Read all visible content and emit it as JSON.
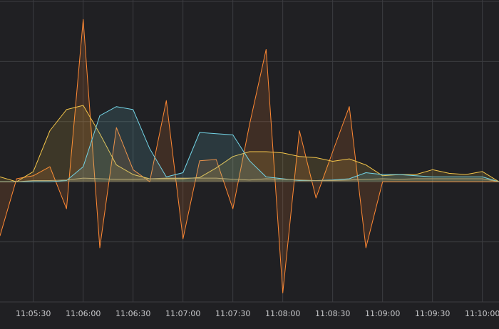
{
  "chart_data": {
    "type": "area",
    "title": "",
    "xlabel": "",
    "ylabel": "",
    "grid": true,
    "legend": "none",
    "xlim": [
      "11:05:10",
      "11:10:10"
    ],
    "ylim": [
      -2,
      3
    ],
    "x_ticks": [
      "11:05:30",
      "11:06:00",
      "11:06:30",
      "11:07:00",
      "11:07:30",
      "11:08:00",
      "11:08:30",
      "11:09:00",
      "11:09:30",
      "11:10:00"
    ],
    "y_grid": [
      -2,
      -1,
      0,
      1,
      2,
      3
    ],
    "x": [
      "11:05:10",
      "11:05:20",
      "11:05:30",
      "11:05:40",
      "11:05:50",
      "11:06:00",
      "11:06:10",
      "11:06:20",
      "11:06:30",
      "11:06:40",
      "11:06:50",
      "11:07:00",
      "11:07:10",
      "11:07:20",
      "11:07:30",
      "11:07:40",
      "11:07:50",
      "11:08:00",
      "11:08:10",
      "11:08:20",
      "11:08:30",
      "11:08:40",
      "11:08:50",
      "11:09:00",
      "11:09:10",
      "11:09:20",
      "11:09:30",
      "11:09:40",
      "11:09:50",
      "11:10:00",
      "11:10:10"
    ],
    "series": [
      {
        "color": "#ff8833",
        "values": [
          -0.9,
          0.05,
          0.1,
          0.25,
          -0.45,
          2.7,
          -1.1,
          0.9,
          0.2,
          0.0,
          1.35,
          -0.95,
          0.35,
          0.37,
          -0.45,
          0.95,
          2.2,
          -1.85,
          0.85,
          -0.27,
          0.5,
          1.25,
          -1.1,
          0.0,
          0.0,
          0.0,
          0.0,
          0.0,
          0.0,
          0.0,
          0.0
        ]
      },
      {
        "color": "#f2c44a",
        "values": [
          0.08,
          0.0,
          0.17,
          0.85,
          1.2,
          1.27,
          0.8,
          0.28,
          0.12,
          0.05,
          0.05,
          0.05,
          0.07,
          0.23,
          0.42,
          0.5,
          0.5,
          0.48,
          0.42,
          0.4,
          0.34,
          0.38,
          0.28,
          0.1,
          0.12,
          0.12,
          0.2,
          0.14,
          0.12,
          0.17,
          0.0
        ]
      },
      {
        "color": "#73d4e6",
        "values": [
          0.0,
          0.0,
          0.0,
          0.0,
          0.02,
          0.25,
          1.1,
          1.25,
          1.2,
          0.55,
          0.08,
          0.15,
          0.82,
          0.8,
          0.78,
          0.35,
          0.08,
          0.05,
          0.02,
          0.02,
          0.03,
          0.05,
          0.15,
          0.12,
          0.12,
          0.1,
          0.08,
          0.08,
          0.08,
          0.08,
          0.0
        ]
      },
      {
        "color": "#b6a873",
        "values": [
          0.0,
          0.0,
          0.02,
          0.02,
          0.03,
          0.06,
          0.05,
          0.04,
          0.04,
          0.05,
          0.06,
          0.06,
          0.06,
          0.06,
          0.04,
          0.03,
          0.05,
          0.04,
          0.03,
          0.02,
          0.02,
          0.03,
          0.04,
          0.05,
          0.04,
          0.05,
          0.05,
          0.05,
          0.05,
          0.05,
          0.0
        ]
      }
    ]
  }
}
